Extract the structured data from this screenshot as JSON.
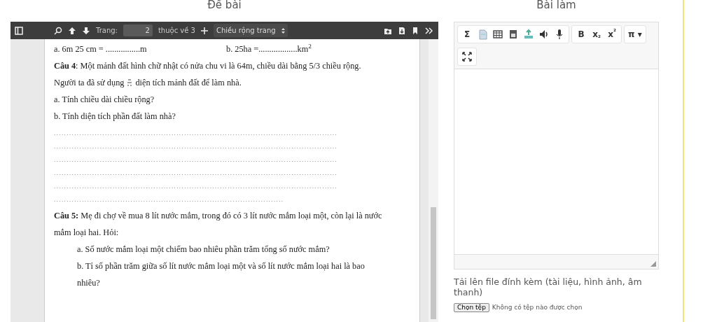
{
  "left_panel": {
    "title": "Đề bài",
    "viewer_toolbar": {
      "page_label": "Trang:",
      "page_value": "2",
      "page_total": "thuộc về 3",
      "zoom": "Chiều rộng trang"
    },
    "document": [
      {
        "kind": "pair",
        "a": "a. 6m 25 cm = ................m",
        "b": "b. 25ha =..................km$^{2}$"
      },
      {
        "kind": "para",
        "text": "**Câu 4**: Một mảnh đất hình chữ nhật có nửa chu vi là 64m, chiều dài bằng 5/3 chiều rộng."
      },
      {
        "kind": "fraction",
        "before": "Người ta đã sử dụng",
        "after": "diện tích mảnh đất để làm nhà."
      },
      {
        "kind": "para",
        "text": "a. Tính chiều dài chiều rộng?"
      },
      {
        "kind": "para",
        "text": "b. Tính diện tích phần đất làm nhà?"
      },
      {
        "kind": "dots",
        "text": "..............................................................................................................."
      },
      {
        "kind": "dots",
        "text": "..............................................................................................................."
      },
      {
        "kind": "dots",
        "text": "..............................................................................................................."
      },
      {
        "kind": "dots",
        "text": "..............................................................................................................."
      },
      {
        "kind": "dots",
        "text": "..............................................................................................................."
      },
      {
        "kind": "dots",
        "text": ".........................................................................................."
      },
      {
        "kind": "para",
        "text": "**Câu 5:** Mẹ đi chợ về mua 8 lít nước mắm, trong đó có 3 lít nước mắm loại một, còn lại là nước mắm loại hai. Hỏi:"
      },
      {
        "kind": "indent",
        "text": "a. Số nước mắm loại một chiếm bao nhiêu phần trăm tổng số nước mắm?"
      },
      {
        "kind": "indent",
        "text": "b. Tỉ số phần trăm giữa số lít nước mắm loại một và số lít nước mắm loại hai là bao nhiêu?"
      }
    ]
  },
  "right_panel": {
    "title": "Bài làm",
    "editor_toolbar": [
      {
        "kind": "text",
        "label": "Σ"
      },
      {
        "kind": "icon"
      },
      {
        "kind": "icon"
      },
      {
        "kind": "icon"
      },
      {
        "kind": "icon"
      },
      {
        "kind": "icon"
      },
      {
        "kind": "icon"
      },
      {
        "kind": "sep"
      },
      {
        "kind": "text",
        "label": "B"
      },
      {
        "kind": "text",
        "label": "x$_{₂}$"
      },
      {
        "kind": "text",
        "label": "x$^{²}$"
      },
      {
        "kind": "sep"
      },
      {
        "kind": "text",
        "label": "π ▾"
      },
      {
        "kind": "break"
      },
      {
        "kind": "icon"
      }
    ],
    "upload_label": "Tải lên file đính kèm (tài liệu, hình ảnh, âm thanh)",
    "file_button": "Chọn tệp",
    "file_status": "Không có tệp nào được chọn"
  }
}
